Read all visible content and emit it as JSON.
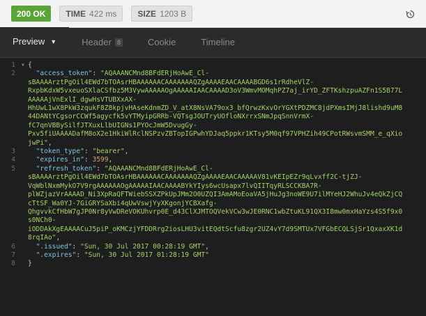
{
  "status": {
    "code_label": "200 OK",
    "time_key": "TIME",
    "time_value": "422 ms",
    "size_key": "SIZE",
    "size_value": "1203 B",
    "ok_color": "#5aa43a"
  },
  "tabs": [
    {
      "label": "Preview",
      "active": true
    },
    {
      "label": "Header",
      "badge": "8"
    },
    {
      "label": "Cookie"
    },
    {
      "label": "Timeline"
    }
  ],
  "json_lines": [
    {
      "n": "1",
      "fold": "▾",
      "text": "{"
    },
    {
      "n": "2",
      "key": "\"access_token\"",
      "str": "\"AQAAANCMnd8BFdERjHoAwE_Cl-"
    },
    {
      "n": "",
      "str": "sBAAAArztPgOil4EWd7bTOAsrHBAAAAAACAAAAAAAQZgAAAAEAACAAAABGD6s1rRdheVlZ-"
    },
    {
      "n": "",
      "str": "RxpbKdxW5vxeuoSXlaCSfbz5M3VywAAAAAOgAAAAAIAACAAAAD3oV3WmvMOMqhPZ7aj_irYD_ZFTKshzpuAZFn1S5B77L"
    },
    {
      "n": "",
      "str": "AAAAAjVnExlI_dgwHsVTUBXxAX-"
    },
    {
      "n": "",
      "str": "HhUwL1wX8PkW3zqukF8Z8kpjvHAseKdnmZD_V_atX8NsVA79ox3_bfQrwzKxvOrYGXtPDZMC8jdPXmsIMjJ8lishd9uM8"
    },
    {
      "n": "",
      "str": "44DANtYCgsorCCWf5agycfk5vYTMyipGRRb-VQTsgJOUTryUOfloNXrrxSNmJpqSnnVrmX-"
    },
    {
      "n": "",
      "str": "fC7qnVBBySilfJTXuxLlbUIGNs1PYOcJmW5DvugGy-"
    },
    {
      "n": "",
      "str": "Pxv5fiUAAAADafM8oX2e1HkiWlRclNSPzvZBTopIGPwhYDJaq5ppkr1KTsy5M0qf97VPHZih49CPotRWsvmSMM_e_qXio"
    },
    {
      "n": "",
      "str": "jwPi\"",
      "tail": ","
    },
    {
      "n": "3",
      "key": "\"token_type\"",
      "str": "\"bearer\"",
      "tail": ","
    },
    {
      "n": "4",
      "key": "\"expires_in\"",
      "num": "3599",
      "tail": ","
    },
    {
      "n": "5",
      "key": "\"refresh_token\"",
      "str": "\"AQAAANCMnd8BFdERjHoAwE_Cl-"
    },
    {
      "n": "",
      "str": "sBAAAArztPgOil4EWd7bTOAsrHBAAAAAACAAAAAAAQZgAAAAEAACAAAAAV81vKEIpEZr9qLvxff2C-tjZJ-"
    },
    {
      "n": "",
      "str": "VqWblNxmMykO7V9rgAAAAAAOgAAAAAIAACAAAABYkYIys6wcUsapx7lvQIITqyRLSCCKBA7R-"
    },
    {
      "n": "",
      "str": "plWZjazVrAAAAD_Ni3XpRaQFTWiebSSXZPkUpJMm2O0UZQI3AmAMoEoaVA5jHuJg3noWE9U7ilMYeHJ2WhuJv4eQkZjCQ"
    },
    {
      "n": "",
      "str": "cTtSF_Wa0YJ-7GiGRYSaXbi4qUwVswjYyXKgonjYCBXafg-"
    },
    {
      "n": "",
      "str": "QhgvvkCfHbW7gJP0Nr8yVwDReVOKUhvrp0E_d43ClXJMTOQVekVCw3wJE0RNC1wbZtuKL91QX3I8mw0mxHaYzs4S5f9x0"
    },
    {
      "n": "",
      "str": "s0NCh0-"
    },
    {
      "n": "",
      "str": "iODDAkXgEAAAACuJ5piP_oKMCzjYFDDRrg2iosLHU3vitEQdtScfu8zgr2UZ4vY7d9SMTUx7VFGbECQLSjSr1QxaxXK1d"
    },
    {
      "n": "",
      "str": "8rqIAo\"",
      "tail": ","
    },
    {
      "n": "6",
      "key": "\".issued\"",
      "str": "\"Sun, 30 Jul 2017 00:28:19 GMT\"",
      "tail": ","
    },
    {
      "n": "7",
      "key": "\".expires\"",
      "str": "\"Sun, 30 Jul 2017 01:28:19 GMT\""
    },
    {
      "n": "8",
      "text": "}"
    }
  ]
}
